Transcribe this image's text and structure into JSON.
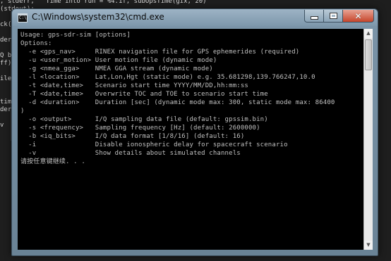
{
  "background_editor": {
    "lines": [
      ", stderr,  \"Time into run = %4.1f, subOpsTime(gix, 20)\"",
      "(stdout);",
      "",
      "ck()",
      "",
      "derr,",
      "",
      "Q buf",
      "ff);",
      "",
      "ile",
      "",
      "",
      "time",
      "derr,",
      "",
      "v"
    ]
  },
  "window": {
    "title": "C:\\Windows\\system32\\cmd.exe",
    "icon_text": "C:\\",
    "controls": {
      "minimize": "minimize",
      "maximize": "maximize",
      "close": "✕"
    }
  },
  "console": {
    "lines": [
      "Usage: gps-sdr-sim [options]",
      "Options:",
      "  -e <gps_nav>     RINEX navigation file for GPS ephemerides (required)",
      "  -u <user_motion> User motion file (dynamic mode)",
      "  -g <nmea_gga>    NMEA GGA stream (dynamic mode)",
      "  -l <location>    Lat,Lon,Hgt (static mode) e.g. 35.681298,139.766247,10.0",
      "  -t <date,time>   Scenario start time YYYY/MM/DD,hh:mm:ss",
      "  -T <date,time>   Overwrite TOC and TOE to scenario start time",
      "  -d <duration>    Duration [sec] (dynamic mode max: 300, static mode max: 86400",
      ")",
      "  -o <output>      I/Q sampling data file (default: gpssim.bin)",
      "  -s <frequency>   Sampling frequency [Hz] (default: 2600000)",
      "  -b <iq_bits>     I/Q data format [1/8/16] (default: 16)",
      "  -i               Disable ionospheric delay for spacecraft scenario",
      "  -v               Show details about simulated channels",
      "请按任意键继续. . ."
    ]
  },
  "colors": {
    "console_bg": "#000000",
    "console_text": "#c0c0c0",
    "titlebar": "#8aa3b6",
    "close_button": "#c6452b"
  }
}
